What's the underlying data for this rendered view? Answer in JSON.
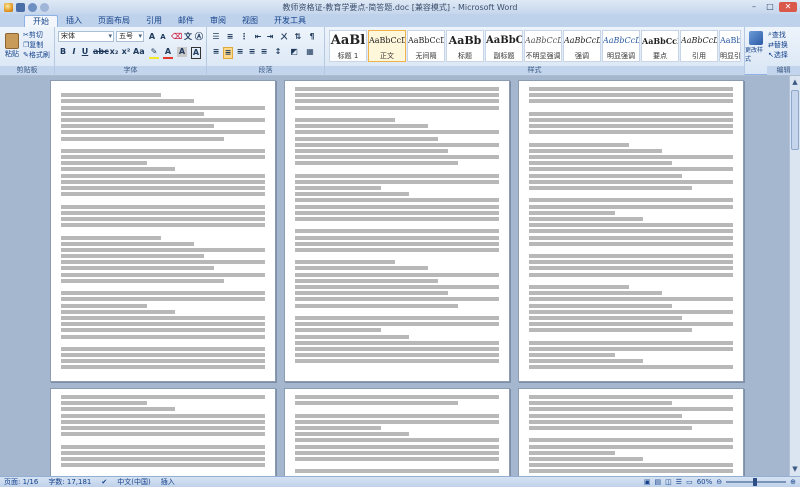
{
  "window": {
    "title": "教师资格证-教育学要点-简答题.doc [兼容模式] - Microsoft Word"
  },
  "tabs": [
    "开始",
    "插入",
    "页面布局",
    "引用",
    "邮件",
    "审阅",
    "视图",
    "开发工具"
  ],
  "clipboard": {
    "paste_label": "粘贴",
    "cut_label": "剪切",
    "copy_label": "复制",
    "format_painter_label": "格式刷",
    "group_label": "剪贴板"
  },
  "font": {
    "family_value": "宋体",
    "size_value": "五号",
    "group_label": "字体"
  },
  "paragraph": {
    "group_label": "段落"
  },
  "styles": {
    "items": [
      {
        "sample": "AaBl",
        "name": "标题 1"
      },
      {
        "sample": "AaBbCcDd",
        "name": "正文"
      },
      {
        "sample": "AaBbCcDd",
        "name": "无间隔"
      },
      {
        "sample": "AaBb",
        "name": "标题"
      },
      {
        "sample": "AaBbC",
        "name": "副标题"
      },
      {
        "sample": "AaBbCcDd",
        "name": "不明显强调"
      },
      {
        "sample": "AaBbCcDd",
        "name": "强调"
      },
      {
        "sample": "AaBbCcDd",
        "name": "明显强调"
      },
      {
        "sample": "AaBbCcDd",
        "name": "要点"
      },
      {
        "sample": "AaBbCcDd",
        "name": "引用"
      },
      {
        "sample": "AaBbCcDd",
        "name": "明显引用"
      }
    ],
    "change_styles_label": "更改样式",
    "group_label": "样式"
  },
  "editing": {
    "find_label": "查找",
    "replace_label": "替换",
    "select_label": "选择",
    "group_label": "编辑"
  },
  "status": {
    "page": "页面: 1/16",
    "words": "字数: 17,181",
    "language": "中文(中国)",
    "mode": "插入",
    "zoom": "60%"
  },
  "colors": {
    "accent": "#15428b",
    "ribbon_bg": "#dbe7f5",
    "doc_bg": "#a4b7cf"
  }
}
